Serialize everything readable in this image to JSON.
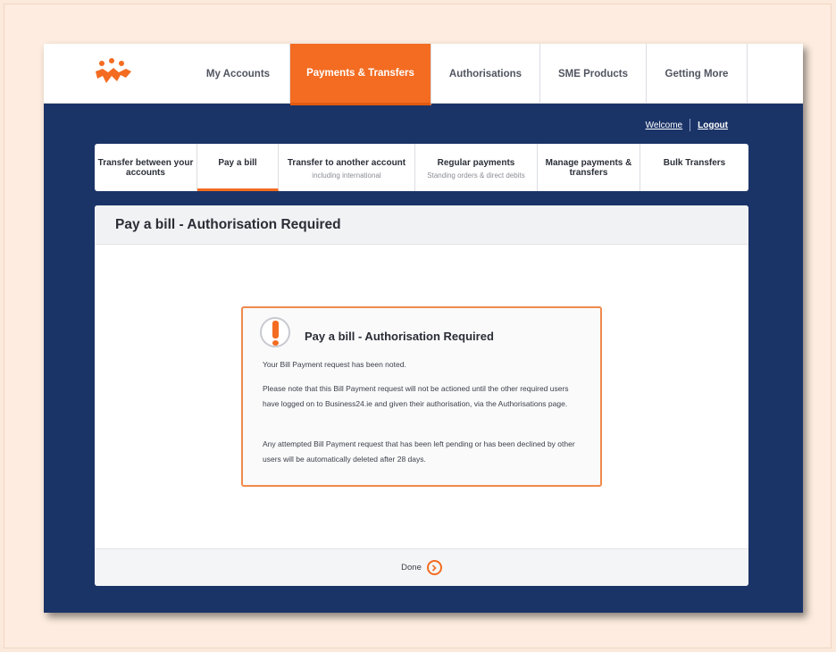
{
  "nav": {
    "items": [
      {
        "label": "My Accounts"
      },
      {
        "label": "Payments & Transfers",
        "active": true
      },
      {
        "label": "Authorisations"
      },
      {
        "label": "SME Products"
      },
      {
        "label": "Getting More"
      }
    ]
  },
  "user": {
    "welcome": "Welcome",
    "logout": "Logout"
  },
  "subtabs": [
    {
      "title": "Transfer between your accounts",
      "sub": ""
    },
    {
      "title": "Pay a bill",
      "sub": "",
      "active": true
    },
    {
      "title": "Transfer to another account",
      "sub": "including international"
    },
    {
      "title": "Regular payments",
      "sub": "Standing orders & direct debits"
    },
    {
      "title": "Manage payments & transfers",
      "sub": ""
    },
    {
      "title": "Bulk Transfers",
      "sub": ""
    }
  ],
  "page": {
    "title": "Pay a bill - Authorisation Required"
  },
  "alert": {
    "title": "Pay a bill - Authorisation Required",
    "p1": "Your Bill Payment request has been noted.",
    "p2": "Please note that this Bill Payment request will not be actioned until the other required users have logged on to Business24.ie and given their authorisation, via the Authorisations page.",
    "p3": "Any attempted Bill Payment request that has been left pending or has been declined by other users will be automatically deleted after 28 days."
  },
  "footer": {
    "done_label": "Done"
  },
  "colors": {
    "brand_orange": "#f36c21",
    "navy": "#1b3468"
  },
  "icons": [
    "logo-icon",
    "exclamation-icon",
    "chevron-right-icon"
  ]
}
